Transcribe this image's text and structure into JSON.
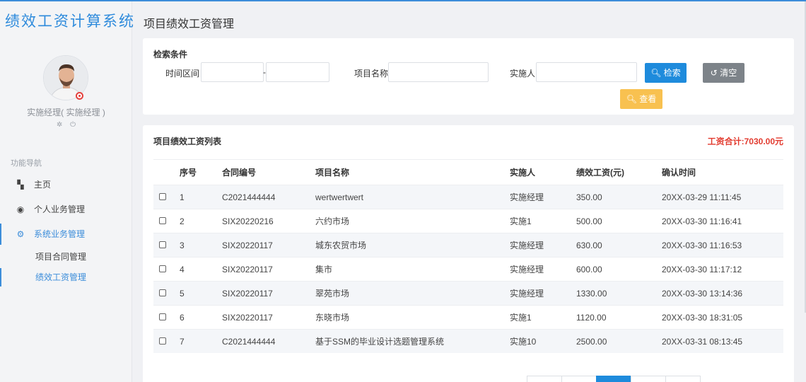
{
  "app": {
    "title": "绩效工资计算系统"
  },
  "user": {
    "name": "实施经理( 实施经理 )",
    "settings_icon": "gear-icon",
    "logout_icon": "power-icon"
  },
  "nav": {
    "section_title": "功能导航",
    "items": [
      {
        "label": "主页",
        "icon": "dashboard-icon",
        "active": false
      },
      {
        "label": "个人业务管理",
        "icon": "user-circle-icon",
        "active": false
      },
      {
        "label": "系统业务管理",
        "icon": "cogs-icon",
        "active": true
      }
    ],
    "sub_items": [
      {
        "label": "项目合同管理",
        "active": false
      },
      {
        "label": "绩效工资管理",
        "active": true
      }
    ]
  },
  "page": {
    "title": "项目绩效工资管理"
  },
  "search": {
    "title": "检索条件",
    "time_label": "时间区间",
    "time_separator": "-",
    "time_start": "",
    "time_end": "",
    "project_label": "项目名称",
    "project_value": "",
    "implementer_label": "实施人",
    "implementer_value": "",
    "search_button": "检索",
    "clear_button": "清空",
    "view_button": "查看"
  },
  "list": {
    "title": "项目绩效工资列表",
    "total": "工资合计:7030.00元",
    "columns": [
      "序号",
      "合同编号",
      "项目名称",
      "实施人",
      "绩效工资(元)",
      "确认时间"
    ],
    "rows": [
      {
        "no": "1",
        "contract": "C2021444444",
        "project": "wertwertwert",
        "implementer": "实施经理",
        "salary": "350.00",
        "time": "20XX-03-29 11:11:45"
      },
      {
        "no": "2",
        "contract": "SIX20220216",
        "project": "六约市场",
        "implementer": "实施1",
        "salary": "500.00",
        "time": "20XX-03-30 11:16:41"
      },
      {
        "no": "3",
        "contract": "SIX20220117",
        "project": "城东农贸市场",
        "implementer": "实施经理",
        "salary": "630.00",
        "time": "20XX-03-30 11:16:53"
      },
      {
        "no": "4",
        "contract": "SIX20220117",
        "project": "集市",
        "implementer": "实施经理",
        "salary": "600.00",
        "time": "20XX-03-30 11:17:12"
      },
      {
        "no": "5",
        "contract": "SIX20220117",
        "project": "翠苑市场",
        "implementer": "实施经理",
        "salary": "1330.00",
        "time": "20XX-03-30 13:14:36"
      },
      {
        "no": "6",
        "contract": "SIX20220117",
        "project": "东晓市场",
        "implementer": "实施1",
        "salary": "1120.00",
        "time": "20XX-03-30 18:31:05"
      },
      {
        "no": "7",
        "contract": "C2021444444",
        "project": "基于SSM的毕业设计选题管理系统",
        "implementer": "实施10",
        "salary": "2500.00",
        "time": "20XX-03-31 08:13:45"
      }
    ]
  },
  "pagination": {
    "pages": [
      "",
      "",
      "",
      "",
      ""
    ],
    "current_index": 2
  },
  "colors": {
    "accent": "#1e8bdc",
    "total": "#e23a2e",
    "warn": "#f8c150",
    "gray_button": "#7d8389"
  }
}
